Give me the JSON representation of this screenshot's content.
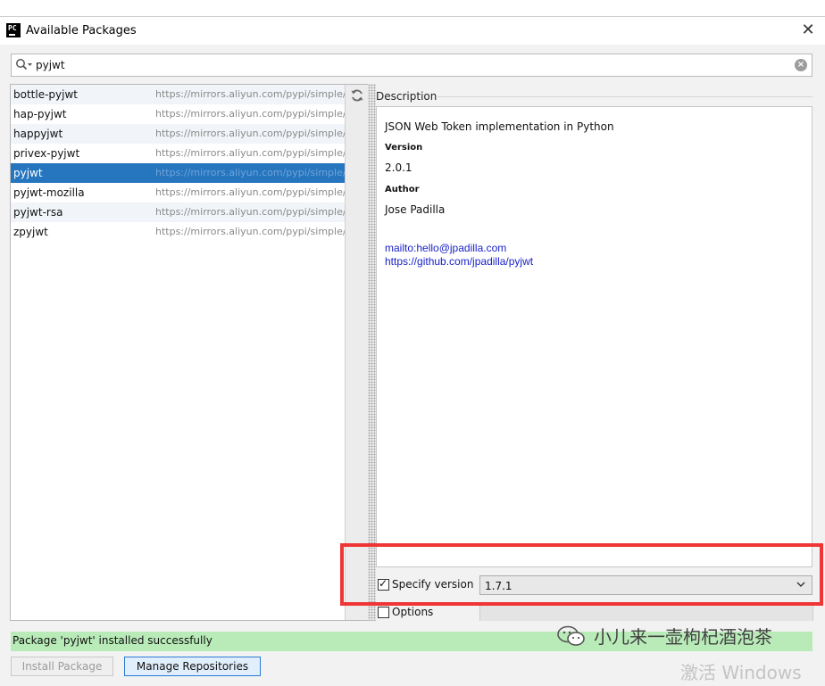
{
  "window": {
    "title": "Available Packages",
    "app_icon_label": "PC"
  },
  "search": {
    "value": "pyjwt"
  },
  "packages": [
    {
      "name": "bottle-pyjwt",
      "url": "https://mirrors.aliyun.com/pypi/simple/"
    },
    {
      "name": "hap-pyjwt",
      "url": "https://mirrors.aliyun.com/pypi/simple/"
    },
    {
      "name": "happyjwt",
      "url": "https://mirrors.aliyun.com/pypi/simple/"
    },
    {
      "name": "privex-pyjwt",
      "url": "https://mirrors.aliyun.com/pypi/simple/"
    },
    {
      "name": "pyjwt",
      "url": "https://mirrors.aliyun.com/pypi/simple/"
    },
    {
      "name": "pyjwt-mozilla",
      "url": "https://mirrors.aliyun.com/pypi/simple/"
    },
    {
      "name": "pyjwt-rsa",
      "url": "https://mirrors.aliyun.com/pypi/simple/"
    },
    {
      "name": "zpyjwt",
      "url": "https://mirrors.aliyun.com/pypi/simple/"
    }
  ],
  "selected_package": "pyjwt",
  "description": {
    "section_label": "Description",
    "summary": "JSON Web Token implementation in Python",
    "version_label": "Version",
    "version": "2.0.1",
    "author_label": "Author",
    "author": "Jose Padilla",
    "link_email": "mailto:hello@jpadilla.com",
    "link_github": "https://github.com/jpadilla/pyjwt"
  },
  "specify_version": {
    "label": "Specify version",
    "checked": true,
    "selected": "1.7.1"
  },
  "options": {
    "label": "Options",
    "checked": false
  },
  "status_message": "Package 'pyjwt' installed successfully",
  "buttons": {
    "install": "Install Package",
    "manage": "Manage Repositories"
  },
  "watermark": {
    "text": "小儿来一壶枸杞酒泡茶",
    "activate": "激活 Windows"
  },
  "colors": {
    "selection": "#2675bf",
    "status_bg": "#b9ebb9",
    "highlight_border": "#ef3535",
    "link": "#1a22c8"
  }
}
